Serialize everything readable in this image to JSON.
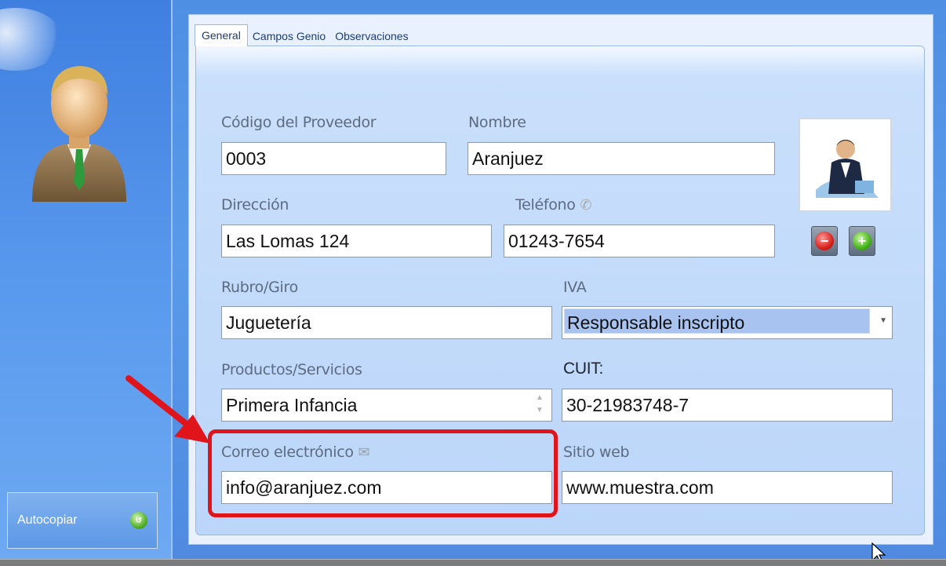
{
  "sidebar": {
    "autocopy_label": "Autocopiar",
    "autocopy_icon": "refresh-icon",
    "autocopy_icon_text": "↺"
  },
  "tabs": [
    {
      "label": "General",
      "active": true
    },
    {
      "label": "Campos Genio",
      "active": false
    },
    {
      "label": "Observaciones",
      "active": false
    }
  ],
  "form": {
    "codigo": {
      "label": "Código del Proveedor",
      "value": "0003"
    },
    "nombre": {
      "label": "Nombre",
      "value": "Aranjuez"
    },
    "direccion": {
      "label": "Dirección",
      "value": "Las Lomas 124"
    },
    "telefono": {
      "label": "Teléfono",
      "value": "01243-7654"
    },
    "rubro": {
      "label": "Rubro/Giro",
      "value": "Juguetería"
    },
    "iva": {
      "label": "IVA",
      "value": "Responsable inscripto"
    },
    "productos": {
      "label": "Productos/Servicios",
      "value": "Primera Infancia"
    },
    "cuit": {
      "label": "CUIT:",
      "value": "30-21983748-7"
    },
    "correo": {
      "label": "Correo electrónico",
      "value": "info@aranjuez.com"
    },
    "sitio": {
      "label": "Sitio web",
      "value": "www.muestra.com"
    }
  },
  "photo_buttons": {
    "remove_symbol": "−",
    "add_symbol": "+"
  },
  "colors": {
    "highlight": "#e0141b",
    "accent": "#4f8fe3"
  }
}
